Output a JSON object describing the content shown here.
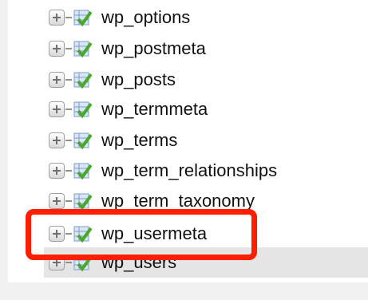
{
  "tree": {
    "rows": [
      {
        "name": "wp_options"
      },
      {
        "name": "wp_postmeta"
      },
      {
        "name": "wp_posts"
      },
      {
        "name": "wp_termmeta"
      },
      {
        "name": "wp_terms"
      },
      {
        "name": "wp_term_relationships"
      },
      {
        "name": "wp_term_taxonomy"
      },
      {
        "name": "wp_usermeta"
      },
      {
        "name": "wp_users"
      }
    ],
    "highlighted_row": "wp_users"
  },
  "callout": {
    "target": "wp_usermeta",
    "color": "#ff1e00"
  },
  "icons": {
    "expander": "expand-plus-icon",
    "table": "table-icon"
  },
  "colors": {
    "background": "#f1f1f1",
    "panel": "#ffffff",
    "row_highlight": "#e5e5e5",
    "table_icon_check": "#49a72a"
  }
}
